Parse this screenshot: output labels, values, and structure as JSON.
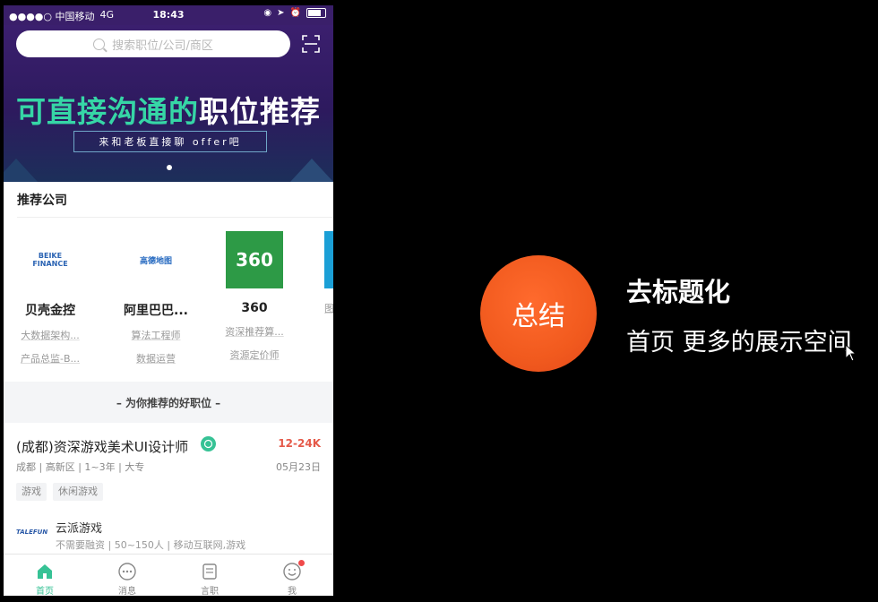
{
  "status_bar": {
    "carrier": "●●●●○ 中国移动",
    "network": "4G",
    "time": "18:43"
  },
  "search": {
    "placeholder": "搜索职位/公司/商区"
  },
  "banner": {
    "title_green": "可直接沟通的",
    "title_white": "职位推荐",
    "subtitle": "来和老板直接聊 offer吧"
  },
  "recommended_companies": {
    "title": "推荐公司",
    "items": [
      {
        "logo_text": "BEIKE FINANCE",
        "name": "贝壳金控",
        "jobs": [
          "大数据架构...",
          "产品总监-B..."
        ]
      },
      {
        "logo_text": "高德地图",
        "name": "阿里巴巴...",
        "jobs": [
          "算法工程师",
          "数据运营"
        ]
      },
      {
        "logo_text": "360",
        "name": "360",
        "jobs": [
          "资深推荐算...",
          "资源定价师"
        ]
      },
      {
        "logo_text": "",
        "name": "",
        "jobs": [
          "图",
          ""
        ]
      }
    ]
  },
  "recommended_jobs_label": "– 为你推荐的好职位 –",
  "job": {
    "title": "(成都)资深游戏美术UI设计师",
    "salary": "12-24K",
    "meta": "成都 | 高新区 | 1~3年 | 大专",
    "date": "05月23日",
    "tags": [
      "游戏",
      "休闲游戏"
    ],
    "company_logo_text": "TALEFUN",
    "company_name": "云派游戏",
    "company_meta": "不需要融资 | 50~150人 | 移动互联网,游戏"
  },
  "tabs": [
    {
      "label": "首页",
      "icon": "home-icon",
      "active": true
    },
    {
      "label": "消息",
      "icon": "chat-icon",
      "active": false
    },
    {
      "label": "言职",
      "icon": "document-icon",
      "active": false
    },
    {
      "label": "我",
      "icon": "smiley-icon",
      "active": false
    }
  ],
  "summary": {
    "circle_label": "总结",
    "title": "去标题化",
    "subtitle": "首页 更多的展示空间"
  },
  "colors": {
    "accent_green": "#36c295",
    "orange": "#f15a1e",
    "salary_red": "#e55a4a"
  }
}
